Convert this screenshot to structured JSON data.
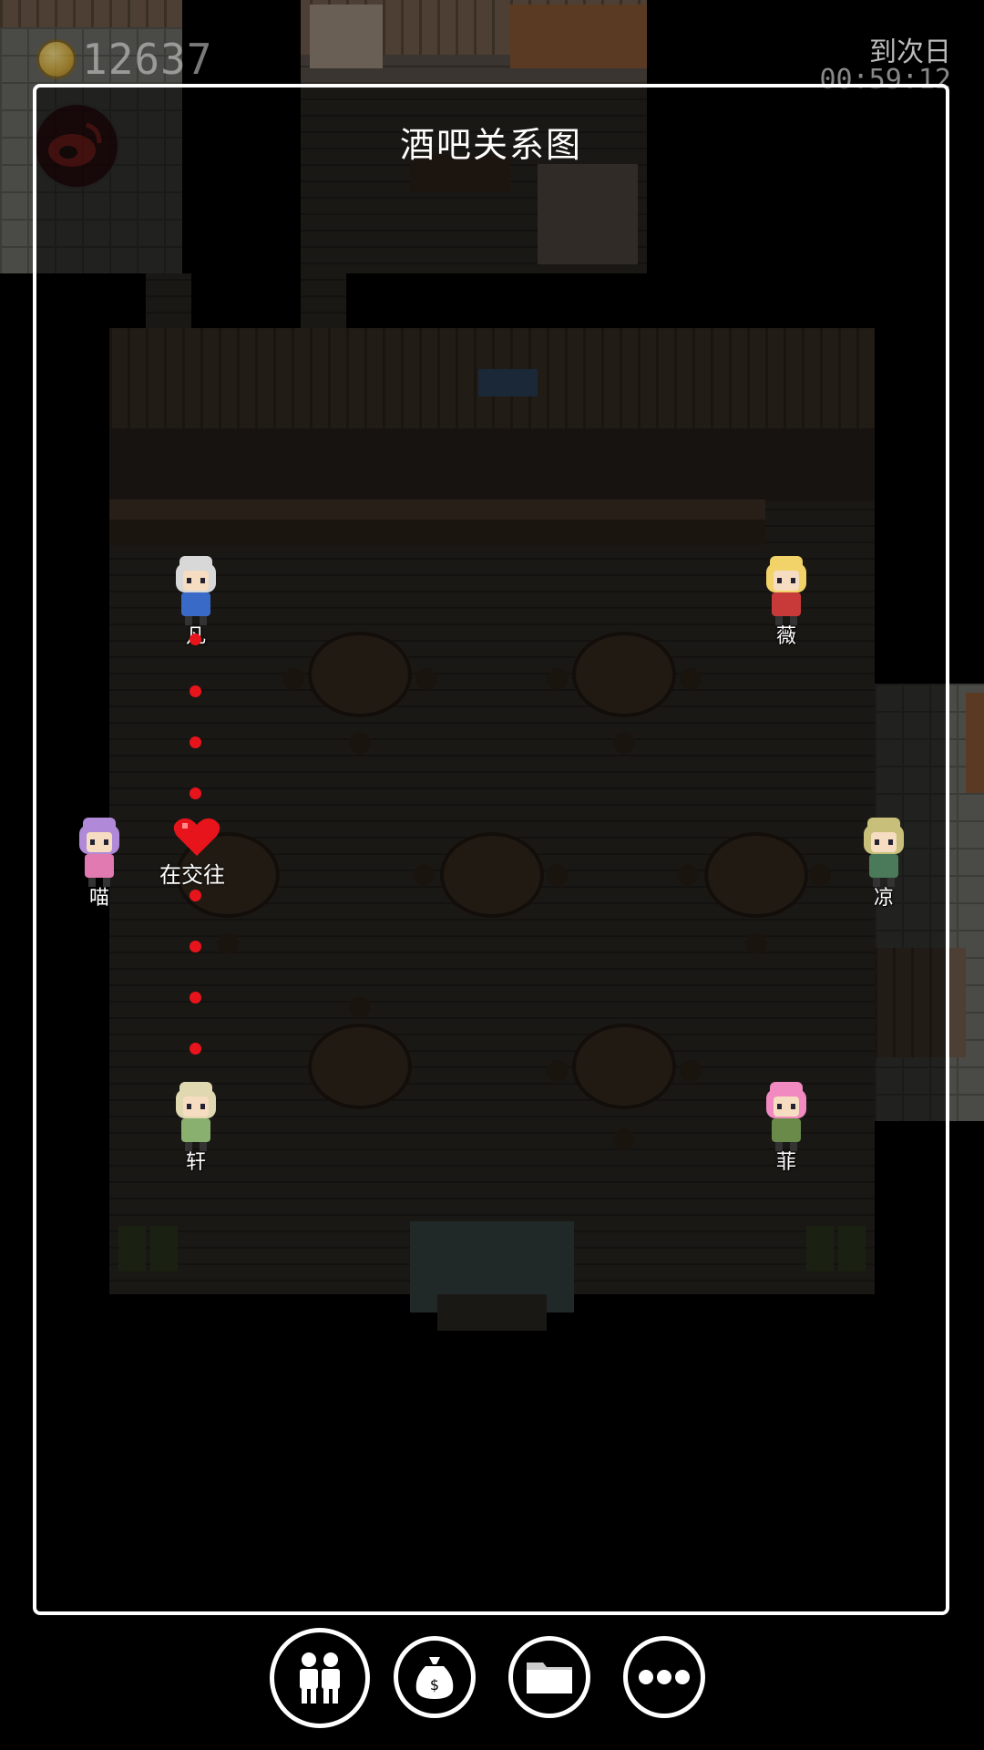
{
  "hud": {
    "coins": "12637",
    "timer_label": "到次日",
    "timer_value": "00:59:12"
  },
  "panel": {
    "title": "酒吧关系图"
  },
  "characters": [
    {
      "name": "凡",
      "palette": "#d8d8d8",
      "cloth": "#3a6ac8"
    },
    {
      "name": "薇",
      "palette": "#f2d36a",
      "cloth": "#c83a3a"
    },
    {
      "name": "喵",
      "palette": "#b08ad8",
      "cloth": "#e07ab0"
    },
    {
      "name": "凉",
      "palette": "#c8c07a",
      "cloth": "#4a7a5a"
    },
    {
      "name": "轩",
      "palette": "#e0d8b0",
      "cloth": "#8ab070"
    },
    {
      "name": "菲",
      "palette": "#f08ac0",
      "cloth": "#6a8a4a"
    }
  ],
  "relationship": {
    "status": "在交往",
    "icon": "heart-icon",
    "color": "#e8141c"
  },
  "toolbar": [
    {
      "icon": "people-icon"
    },
    {
      "icon": "money-bag-icon"
    },
    {
      "icon": "folder-icon"
    },
    {
      "icon": "more-icon"
    }
  ]
}
